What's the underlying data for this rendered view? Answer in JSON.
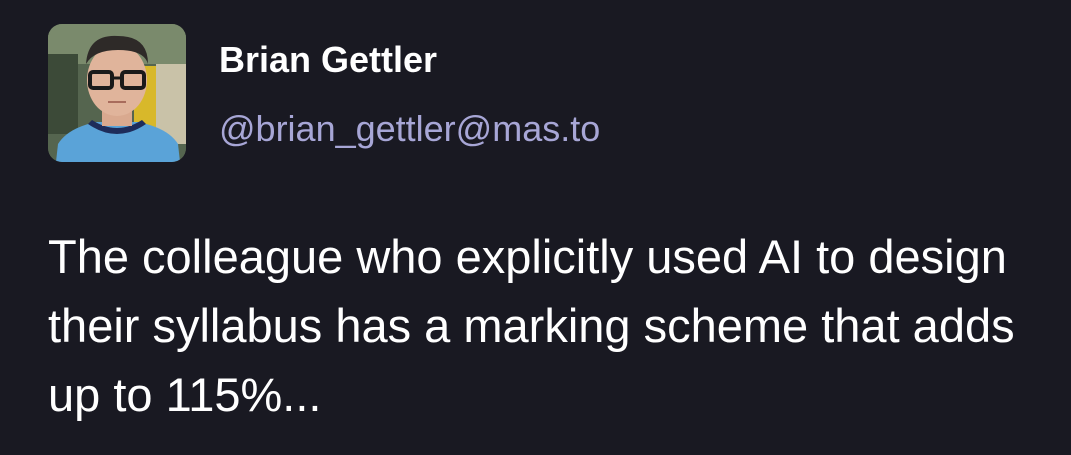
{
  "author": {
    "display_name": "Brian Gettler",
    "handle": "@brian_gettler@mas.to",
    "avatar_icon": "profile-photo"
  },
  "post": {
    "body": "The colleague who explicitly used AI to design their syllabus has a marking scheme that adds up to 115%..."
  },
  "colors": {
    "background": "#191922",
    "name": "#ffffff",
    "handle": "#a7a6d6",
    "body": "#ffffff"
  }
}
